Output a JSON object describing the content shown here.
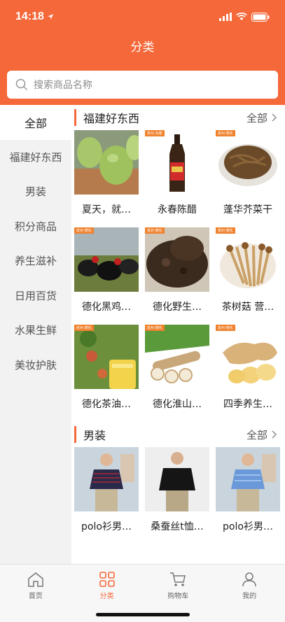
{
  "status": {
    "time": "14:18"
  },
  "header": {
    "title": "分类"
  },
  "search": {
    "placeholder": "搜索商品名称"
  },
  "sidebar": {
    "items": [
      {
        "label": "全部",
        "active": true
      },
      {
        "label": "福建好东西"
      },
      {
        "label": "男装"
      },
      {
        "label": "积分商品"
      },
      {
        "label": "养生滋补"
      },
      {
        "label": "日用百货"
      },
      {
        "label": "水果生鲜"
      },
      {
        "label": "美妆护肤"
      }
    ]
  },
  "sections": [
    {
      "title": "福建好东西",
      "more": "全部",
      "products": [
        {
          "name": "夏天，就…",
          "image": "green-plums"
        },
        {
          "name": "永春陈醋",
          "image": "vinegar-bottle",
          "tag": "泉州·永春"
        },
        {
          "name": "蓬华芥菜干",
          "image": "dried-vegetables",
          "tag": "泉州·德化"
        },
        {
          "name": "德化黑鸡…",
          "image": "black-chickens",
          "tag": "泉州·德化"
        },
        {
          "name": "德化野生…",
          "image": "dried-tea-leaves",
          "tag": "泉州·德化"
        },
        {
          "name": "茶树菇 营…",
          "image": "tea-mushrooms",
          "tag": "泉州·德化"
        },
        {
          "name": "德化茶油…",
          "image": "tea-oil",
          "tag": "泉州·德化"
        },
        {
          "name": "德化淮山…",
          "image": "yam",
          "tag": "泉州·德化"
        },
        {
          "name": "四季养生…",
          "image": "ginger",
          "tag": "泉州·德化"
        }
      ]
    },
    {
      "title": "男装",
      "more": "全部",
      "products": [
        {
          "name": "polo衫男…",
          "image": "polo-striped"
        },
        {
          "name": "桑蚕丝t恤…",
          "image": "silk-tshirt"
        },
        {
          "name": "polo衫男…",
          "image": "polo-blue"
        }
      ]
    }
  ],
  "tabbar": [
    {
      "label": "首页",
      "icon": "home-icon"
    },
    {
      "label": "分类",
      "icon": "category-icon",
      "active": true
    },
    {
      "label": "购物车",
      "icon": "cart-icon"
    },
    {
      "label": "我的",
      "icon": "user-icon"
    }
  ],
  "colors": {
    "accent": "#f5683a",
    "tag": "#f0822e"
  }
}
